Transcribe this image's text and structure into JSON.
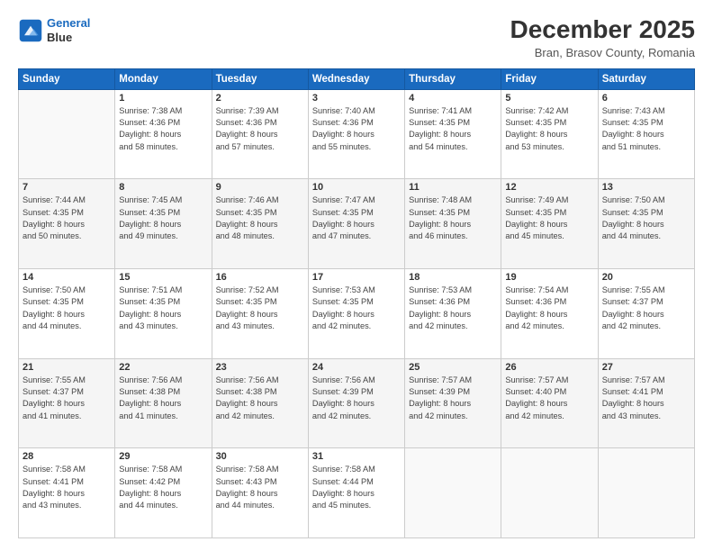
{
  "header": {
    "logo_line1": "General",
    "logo_line2": "Blue",
    "title": "December 2025",
    "subtitle": "Bran, Brasov County, Romania"
  },
  "weekdays": [
    "Sunday",
    "Monday",
    "Tuesday",
    "Wednesday",
    "Thursday",
    "Friday",
    "Saturday"
  ],
  "weeks": [
    [
      {
        "day": "",
        "info": ""
      },
      {
        "day": "1",
        "info": "Sunrise: 7:38 AM\nSunset: 4:36 PM\nDaylight: 8 hours\nand 58 minutes."
      },
      {
        "day": "2",
        "info": "Sunrise: 7:39 AM\nSunset: 4:36 PM\nDaylight: 8 hours\nand 57 minutes."
      },
      {
        "day": "3",
        "info": "Sunrise: 7:40 AM\nSunset: 4:36 PM\nDaylight: 8 hours\nand 55 minutes."
      },
      {
        "day": "4",
        "info": "Sunrise: 7:41 AM\nSunset: 4:35 PM\nDaylight: 8 hours\nand 54 minutes."
      },
      {
        "day": "5",
        "info": "Sunrise: 7:42 AM\nSunset: 4:35 PM\nDaylight: 8 hours\nand 53 minutes."
      },
      {
        "day": "6",
        "info": "Sunrise: 7:43 AM\nSunset: 4:35 PM\nDaylight: 8 hours\nand 51 minutes."
      }
    ],
    [
      {
        "day": "7",
        "info": "Sunrise: 7:44 AM\nSunset: 4:35 PM\nDaylight: 8 hours\nand 50 minutes."
      },
      {
        "day": "8",
        "info": "Sunrise: 7:45 AM\nSunset: 4:35 PM\nDaylight: 8 hours\nand 49 minutes."
      },
      {
        "day": "9",
        "info": "Sunrise: 7:46 AM\nSunset: 4:35 PM\nDaylight: 8 hours\nand 48 minutes."
      },
      {
        "day": "10",
        "info": "Sunrise: 7:47 AM\nSunset: 4:35 PM\nDaylight: 8 hours\nand 47 minutes."
      },
      {
        "day": "11",
        "info": "Sunrise: 7:48 AM\nSunset: 4:35 PM\nDaylight: 8 hours\nand 46 minutes."
      },
      {
        "day": "12",
        "info": "Sunrise: 7:49 AM\nSunset: 4:35 PM\nDaylight: 8 hours\nand 45 minutes."
      },
      {
        "day": "13",
        "info": "Sunrise: 7:50 AM\nSunset: 4:35 PM\nDaylight: 8 hours\nand 44 minutes."
      }
    ],
    [
      {
        "day": "14",
        "info": "Sunrise: 7:50 AM\nSunset: 4:35 PM\nDaylight: 8 hours\nand 44 minutes."
      },
      {
        "day": "15",
        "info": "Sunrise: 7:51 AM\nSunset: 4:35 PM\nDaylight: 8 hours\nand 43 minutes."
      },
      {
        "day": "16",
        "info": "Sunrise: 7:52 AM\nSunset: 4:35 PM\nDaylight: 8 hours\nand 43 minutes."
      },
      {
        "day": "17",
        "info": "Sunrise: 7:53 AM\nSunset: 4:35 PM\nDaylight: 8 hours\nand 42 minutes."
      },
      {
        "day": "18",
        "info": "Sunrise: 7:53 AM\nSunset: 4:36 PM\nDaylight: 8 hours\nand 42 minutes."
      },
      {
        "day": "19",
        "info": "Sunrise: 7:54 AM\nSunset: 4:36 PM\nDaylight: 8 hours\nand 42 minutes."
      },
      {
        "day": "20",
        "info": "Sunrise: 7:55 AM\nSunset: 4:37 PM\nDaylight: 8 hours\nand 42 minutes."
      }
    ],
    [
      {
        "day": "21",
        "info": "Sunrise: 7:55 AM\nSunset: 4:37 PM\nDaylight: 8 hours\nand 41 minutes."
      },
      {
        "day": "22",
        "info": "Sunrise: 7:56 AM\nSunset: 4:38 PM\nDaylight: 8 hours\nand 41 minutes."
      },
      {
        "day": "23",
        "info": "Sunrise: 7:56 AM\nSunset: 4:38 PM\nDaylight: 8 hours\nand 42 minutes."
      },
      {
        "day": "24",
        "info": "Sunrise: 7:56 AM\nSunset: 4:39 PM\nDaylight: 8 hours\nand 42 minutes."
      },
      {
        "day": "25",
        "info": "Sunrise: 7:57 AM\nSunset: 4:39 PM\nDaylight: 8 hours\nand 42 minutes."
      },
      {
        "day": "26",
        "info": "Sunrise: 7:57 AM\nSunset: 4:40 PM\nDaylight: 8 hours\nand 42 minutes."
      },
      {
        "day": "27",
        "info": "Sunrise: 7:57 AM\nSunset: 4:41 PM\nDaylight: 8 hours\nand 43 minutes."
      }
    ],
    [
      {
        "day": "28",
        "info": "Sunrise: 7:58 AM\nSunset: 4:41 PM\nDaylight: 8 hours\nand 43 minutes."
      },
      {
        "day": "29",
        "info": "Sunrise: 7:58 AM\nSunset: 4:42 PM\nDaylight: 8 hours\nand 44 minutes."
      },
      {
        "day": "30",
        "info": "Sunrise: 7:58 AM\nSunset: 4:43 PM\nDaylight: 8 hours\nand 44 minutes."
      },
      {
        "day": "31",
        "info": "Sunrise: 7:58 AM\nSunset: 4:44 PM\nDaylight: 8 hours\nand 45 minutes."
      },
      {
        "day": "",
        "info": ""
      },
      {
        "day": "",
        "info": ""
      },
      {
        "day": "",
        "info": ""
      }
    ]
  ]
}
